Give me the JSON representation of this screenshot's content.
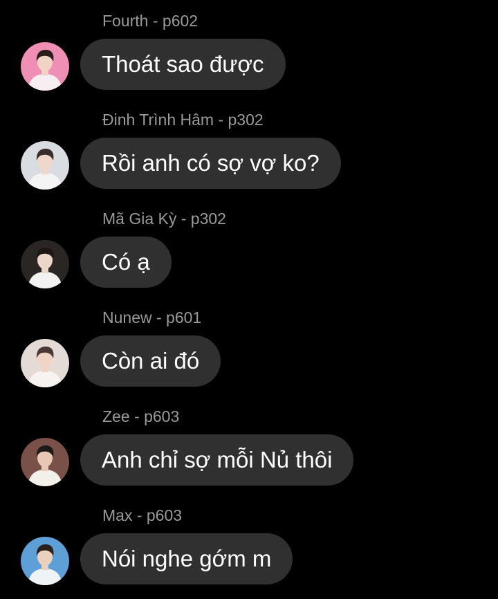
{
  "messages": [
    {
      "sender": "Fourth - p602",
      "text": "Thoát sao được",
      "avatar": {
        "bg": "#ef8fb6",
        "skin": "#f1d2c4",
        "hair": "#2b1d1a",
        "shirt": "#f6eef0"
      }
    },
    {
      "sender": "Đinh Trình Hâm - p302",
      "text": "Rồi anh có sợ vợ ko?",
      "avatar": {
        "bg": "#d9dde2",
        "skin": "#efd8cb",
        "hair": "#3a2d28",
        "shirt": "#f4f4f4"
      }
    },
    {
      "sender": "Mã Gia Kỳ - p302",
      "text": "Có ạ",
      "avatar": {
        "bg": "#2a2624",
        "skin": "#ecd6c8",
        "hair": "#1c1614",
        "shirt": "#f2f2f2"
      }
    },
    {
      "sender": "Nunew - p601",
      "text": "Còn ai đó",
      "avatar": {
        "bg": "#e4dbd6",
        "skin": "#f0d5c5",
        "hair": "#4a3a33",
        "shirt": "#f7f3f0"
      }
    },
    {
      "sender": "Zee - p603",
      "text": "Anh chỉ sợ mỗi Nủ thôi",
      "avatar": {
        "bg": "#7a5148",
        "skin": "#e8c7b4",
        "hair": "#1e1a18",
        "shirt": "#f3efe9"
      }
    },
    {
      "sender": "Max - p603",
      "text": "Nói nghe gớm m",
      "avatar": {
        "bg": "#5f9fd8",
        "skin": "#ecd0be",
        "hair": "#2a211d",
        "shirt": "#eef3f6"
      }
    }
  ]
}
